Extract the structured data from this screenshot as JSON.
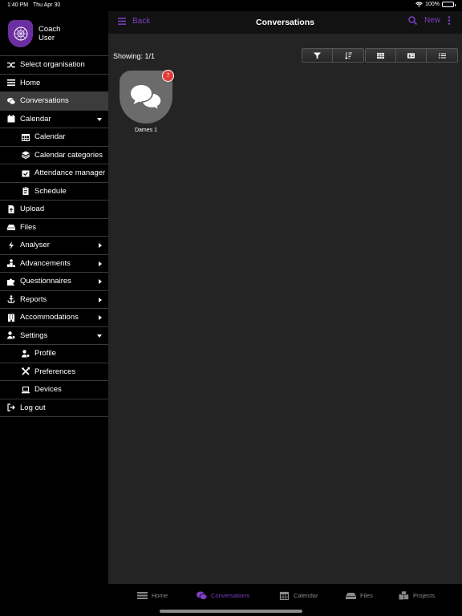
{
  "statusbar": {
    "time": "1:40 PM",
    "date": "Thu Apr 30",
    "battery": "100%",
    "battery_level": 1.0
  },
  "profile": {
    "line1": "Coach",
    "line2": "User"
  },
  "menu": {
    "select_org": "Select organisation",
    "home": "Home",
    "conversations": "Conversations",
    "calendar": "Calendar",
    "calendar_sub": "Calendar",
    "calendar_categories": "Calendar categories",
    "attendance_manager": "Attendance manager",
    "schedule": "Schedule",
    "upload": "Upload",
    "files": "Files",
    "analyser": "Analyser",
    "advancements": "Advancements",
    "questionnaires": "Questionnaires",
    "reports": "Reports",
    "accommodations": "Accommodations",
    "settings": "Settings",
    "profile": "Profile",
    "preferences": "Preferences",
    "devices": "Devices",
    "logout": "Log out"
  },
  "header": {
    "back": "Back",
    "title": "Conversations",
    "new": "New"
  },
  "main": {
    "showing": "Showing: 1/1",
    "conversation": {
      "name": "Dames 1",
      "badge": "7"
    }
  },
  "tabbar": {
    "home": "Home",
    "conversations": "Conversations",
    "calendar": "Calendar",
    "files": "Files",
    "projects": "Projects"
  },
  "colors": {
    "accent": "#7d3fc4",
    "badge": "#e23a3a",
    "background": "#242424"
  }
}
